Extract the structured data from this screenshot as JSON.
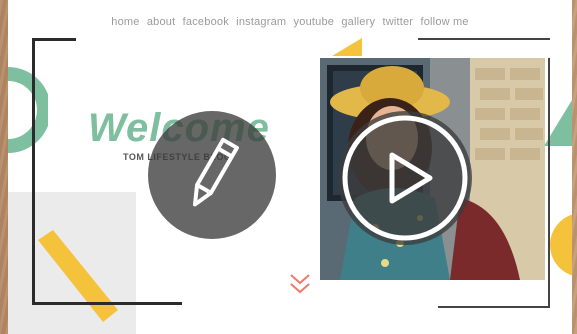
{
  "nav": {
    "items": [
      "home",
      "about",
      "facebook",
      "instagram",
      "youtube",
      "gallery",
      "twitter",
      "follow me"
    ]
  },
  "hero": {
    "title": "Welcome",
    "tagline": "TOM LIFESTYLE BLOG"
  },
  "overlays": {
    "edit_icon": "pencil-icon",
    "play_icon": "play-icon"
  },
  "colors": {
    "accent_green": "#7dbf9f",
    "accent_yellow": "#f5c23c",
    "frame": "#2b2b2b"
  }
}
